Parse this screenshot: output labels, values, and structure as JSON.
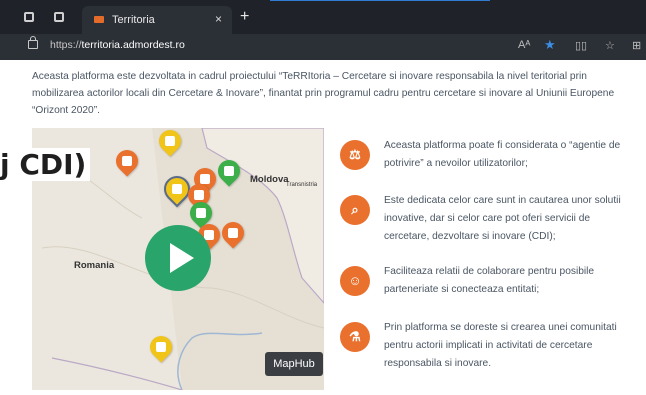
{
  "browser": {
    "tab_title": "Territoria",
    "tab_close": "×",
    "new_tab": "+",
    "url_prefix": "https://",
    "url_host": "territoria.admordest.ro",
    "reader_icon_text": "Aᴬ",
    "star_icon": "★",
    "split_icon": "▯▯",
    "fav_icon": "☆",
    "more_icon": "⊞"
  },
  "page": {
    "intro": "Aceasta platforma este dezvoltata in cadrul proiectului “TeRRItoria – Cercetare si inovare responsabila la nivel teritorial prin mobilizarea actorilor locali din Cercetare & Inovare”, finantat prin programul cadru pentru cercetare si inovare al Uniunii Europene “Orizont 2020”.",
    "overlay_text": "j CDI)",
    "map": {
      "label_moldova": "Moldova",
      "label_transnistria": "Transnistria",
      "label_romania": "Romania",
      "maphub_button": "MapHub"
    },
    "features": [
      {
        "icon": "⚖",
        "icon_name": "scale-icon",
        "text": "Aceasta platforma poate fi considerata o “agentie de potrivire” a nevoilor utilizatorilor;"
      },
      {
        "icon": "⌕",
        "icon_name": "search-icon",
        "text": "Este dedicata celor care sunt in cautarea unor solutii inovative, dar si celor care pot oferi servicii de cercetare, dezvoltare si inovare (CDI);"
      },
      {
        "icon": "☺",
        "icon_name": "handshake-icon",
        "text": "Faciliteaza relatii de colaborare pentru posibile parteneriate si conecteaza entitati;"
      },
      {
        "icon": "⚗",
        "icon_name": "microscope-icon",
        "text": "Prin platforma se doreste si crearea unei comunitati pentru actorii implicati in activitati de cercetare responsabila si inovare."
      }
    ]
  },
  "colors": {
    "accent_orange": "#e9712d",
    "play_green": "#29a56b",
    "pin_yellow": "#f0c419",
    "pin_green": "#3cae4a"
  }
}
